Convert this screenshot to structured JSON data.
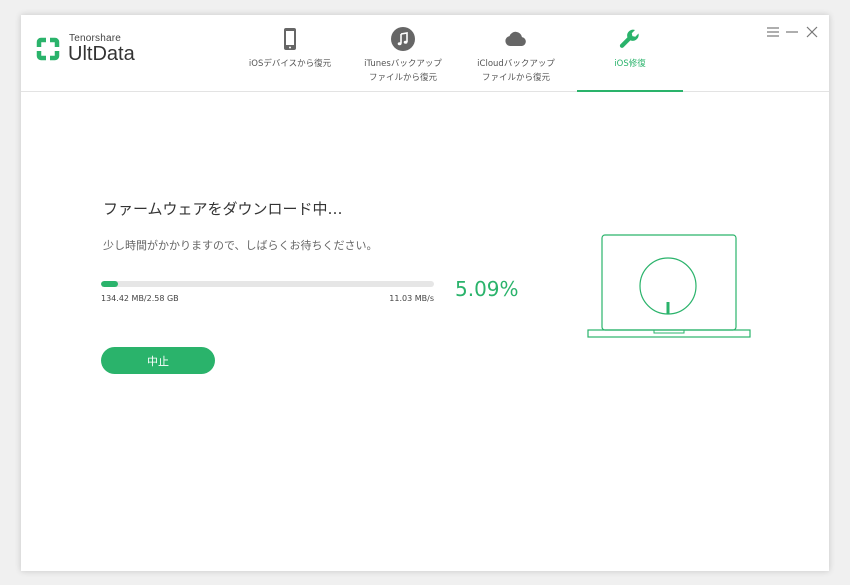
{
  "app": {
    "brand_small": "Tenorshare",
    "brand_name": "UltData"
  },
  "tabs": [
    {
      "line1": "iOSデバイスから復元",
      "line2": "",
      "icon": "phone-icon",
      "active": false
    },
    {
      "line1": "iTunesバックアップ",
      "line2": "ファイルから復元",
      "icon": "music-note-icon",
      "active": false
    },
    {
      "line1": "iCloudバックアップ",
      "line2": "ファイルから復元",
      "icon": "cloud-icon",
      "active": false
    },
    {
      "line1": "iOS修復",
      "line2": "",
      "icon": "wrench-icon",
      "active": true
    }
  ],
  "download": {
    "title": "ファームウェアをダウンロード中…",
    "subtitle": "少し時間がかかりますので、しばらくお待ちください。",
    "progress_percent": 5.09,
    "percent_label": "5.09%",
    "size_label": "134.42 MB/2.58 GB",
    "speed_label": "11.03 MB/s",
    "stop_label": "中止"
  },
  "colors": {
    "accent": "#2ab36b",
    "icon_gray": "#666666"
  }
}
